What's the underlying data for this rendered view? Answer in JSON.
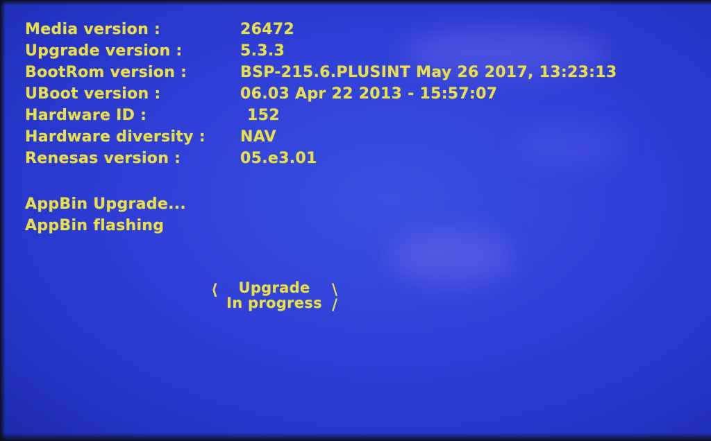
{
  "info": {
    "rows": [
      {
        "label": "Media version :",
        "value": "26472"
      },
      {
        "label": "Upgrade version :",
        "value": "5.3.3"
      },
      {
        "label": "BootRom version :",
        "value": "BSP-215.6.PLUSINT May 26 2017, 13:23:13"
      },
      {
        "label": "UBoot version :",
        "value": "06.03 Apr 22 2013 - 15:57:07"
      },
      {
        "label": "Hardware ID :",
        "value": "152"
      },
      {
        "label": "Hardware diversity :",
        "value": "NAV"
      },
      {
        "label": "Renesas version :",
        "value": "05.e3.01"
      }
    ]
  },
  "status": {
    "line1": "AppBin Upgrade...",
    "line2": "AppBin flashing"
  },
  "progress": {
    "line1": "Upgrade",
    "line2": "In progress"
  },
  "colors": {
    "background": "#2f3fd8",
    "text": "#e8e04a"
  }
}
